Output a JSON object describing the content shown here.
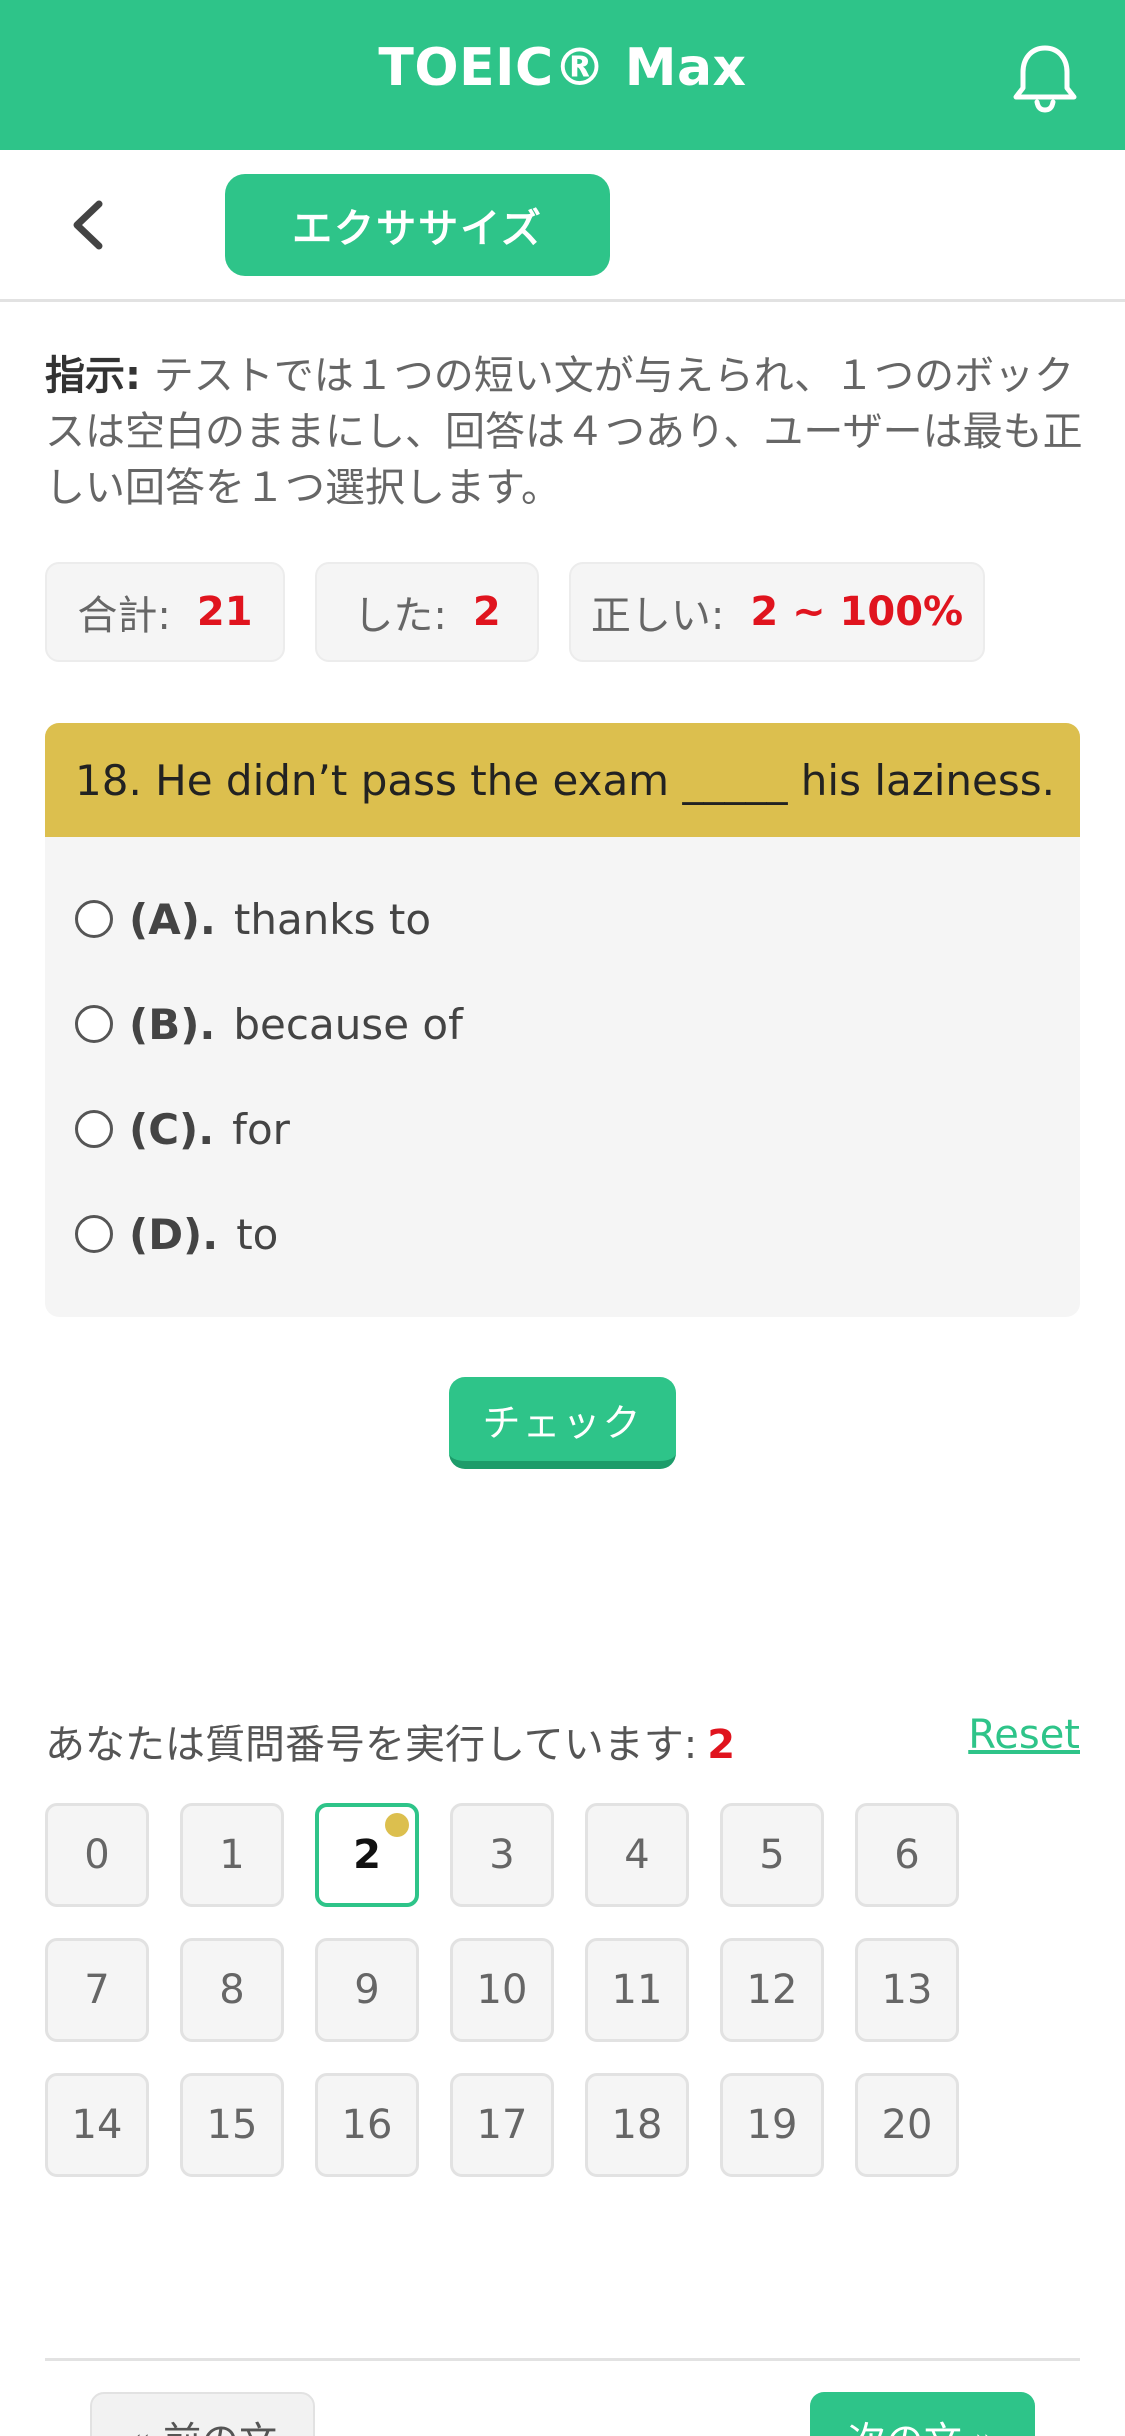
{
  "header": {
    "title": "TOEIC® Max",
    "bell_icon": "bell-icon"
  },
  "subbar": {
    "back_icon": "chevron-left-icon",
    "exercise_label": "エクササイズ"
  },
  "instructions": {
    "label": "指示:",
    "text": " テストでは１つの短い文が与えられ、１つのボックスは空白のままにし、回答は４つあり、ユーザーは最も正しい回答を１つ選択します。"
  },
  "stats": {
    "total_label": "合計:",
    "total_value": "21",
    "done_label": "した:",
    "done_value": "2",
    "correct_label": "正しい:",
    "correct_value": "2 ~ 100%"
  },
  "question": {
    "text": "18. He didn’t pass the exam _____ his laziness.",
    "options": [
      {
        "key": "(A).",
        "text": "thanks to"
      },
      {
        "key": "(B).",
        "text": "because of"
      },
      {
        "key": "(C).",
        "text": "for"
      },
      {
        "key": "(D).",
        "text": "to"
      }
    ]
  },
  "check_label": "チェック",
  "navigator": {
    "running_label": "あなたは質問番号を実行しています:",
    "current": "2",
    "reset_label": "Reset",
    "numbers": [
      "0",
      "1",
      "2",
      "3",
      "4",
      "5",
      "6",
      "7",
      "8",
      "9",
      "10",
      "11",
      "12",
      "13",
      "14",
      "15",
      "16",
      "17",
      "18",
      "19",
      "20"
    ]
  },
  "footer": {
    "prev_label": "« 前の文",
    "next_label": "次の文 »"
  },
  "colors": {
    "brand": "#2ec489",
    "question_header": "#dcbf4e",
    "highlight": "#e0141e"
  }
}
